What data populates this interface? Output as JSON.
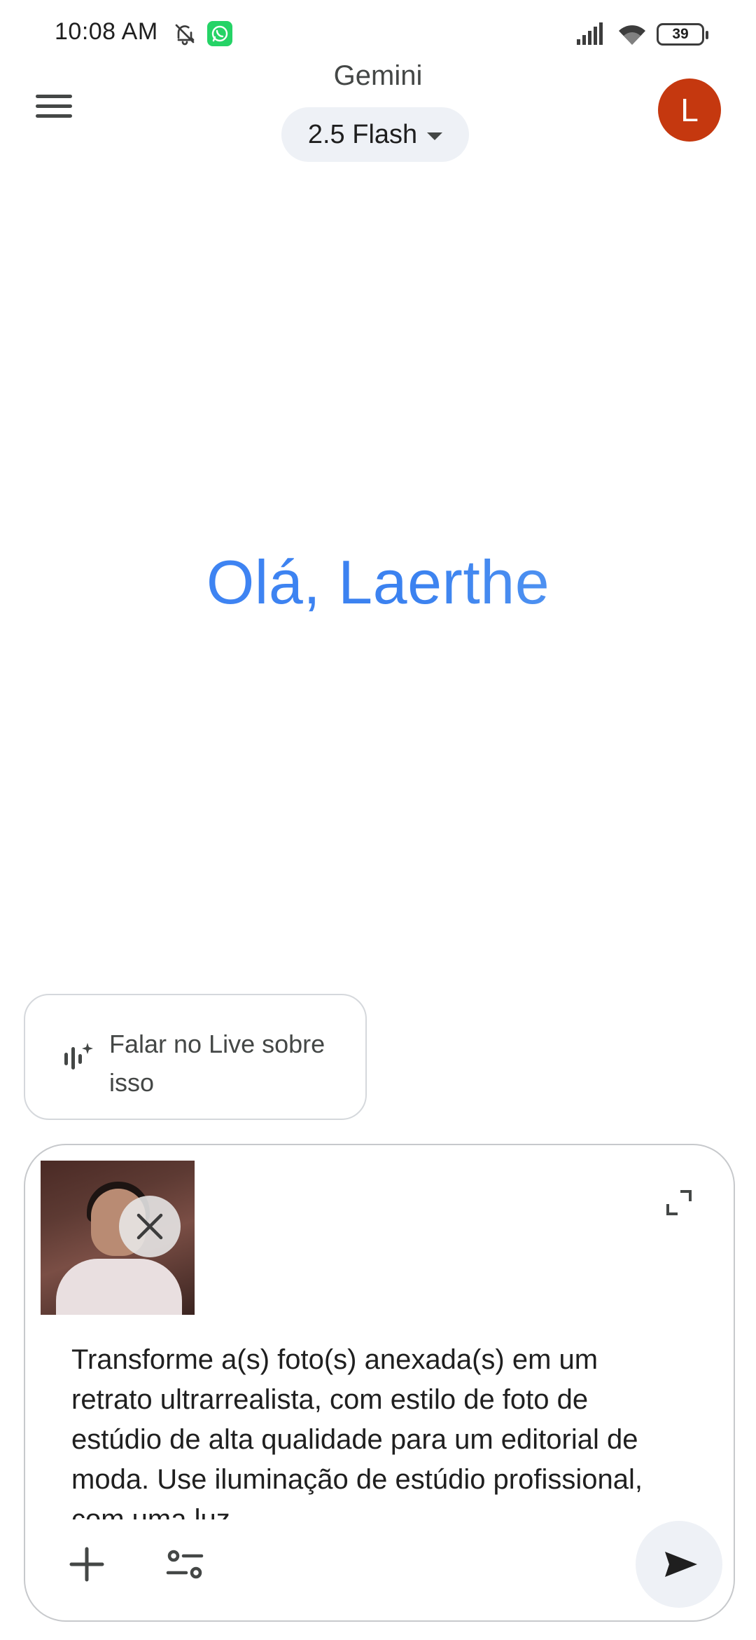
{
  "status_bar": {
    "time": "10:08 AM",
    "battery": "39",
    "icons": [
      "bell-off-icon",
      "whatsapp-icon",
      "signal-icon",
      "wifi-icon",
      "battery-icon"
    ]
  },
  "header": {
    "title": "Gemini",
    "model_label": "2.5 Flash",
    "avatar_initial": "L",
    "avatar_color": "#c5380f"
  },
  "greeting": "Olá, Laerthe",
  "live_chip": {
    "label": "Falar no Live sobre isso",
    "icon": "live-waveform-icon"
  },
  "composer": {
    "attachment": "photo-thumbnail",
    "prompt": "Transforme a(s) foto(s) anexada(s) em um retrato ultrarrealista, com estilo de foto de estúdio de alta qualidade para um editorial de moda. Use iluminação de estúdio profissional, com uma luz",
    "icons": [
      "close-icon",
      "expand-icon",
      "plus-icon",
      "tools-icon",
      "send-icon"
    ]
  },
  "colors": {
    "accent_blue": "#4285f4",
    "pill_bg": "#eef1f6",
    "text_primary": "#1f1f1f",
    "text_secondary": "#444746"
  }
}
